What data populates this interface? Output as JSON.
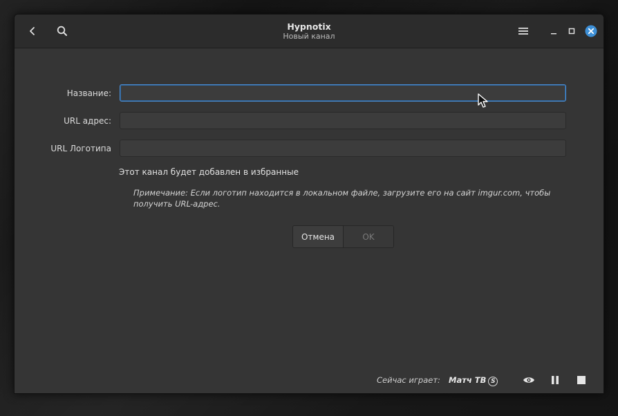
{
  "window": {
    "title": "Hypnotix",
    "subtitle": "Новый канал"
  },
  "header": {
    "back_icon": "chevron-left-icon",
    "search_icon": "search-icon",
    "menu_icon": "hamburger-menu-icon",
    "minimize_icon": "minimize-icon",
    "maximize_icon": "maximize-icon",
    "close_icon": "close-icon",
    "close_color": "#3d8fd6"
  },
  "form": {
    "name_label": "Название:",
    "name_value": "",
    "url_label": "URL адрес:",
    "url_value": "",
    "logo_label": "URL Логотипа",
    "logo_value": "",
    "favorite_text": "Этот канал будет добавлен в избранные",
    "note_text": "Примечание: Если логотип находится в локальном файле, загрузите его на сайт imgur.com, чтобы получить URL-адрес."
  },
  "buttons": {
    "cancel_label": "Отмена",
    "ok_label": "OK"
  },
  "footer": {
    "now_playing_label": "Сейчас играет:",
    "channel_name": "Матч ТВ",
    "channel_badge": "S",
    "eye_icon": "eye-icon",
    "pause_icon": "pause-icon",
    "stop_icon": "stop-icon"
  },
  "colors": {
    "accent": "#4a90d9",
    "window_bg": "#353535",
    "header_bg": "#2c2c2c"
  }
}
